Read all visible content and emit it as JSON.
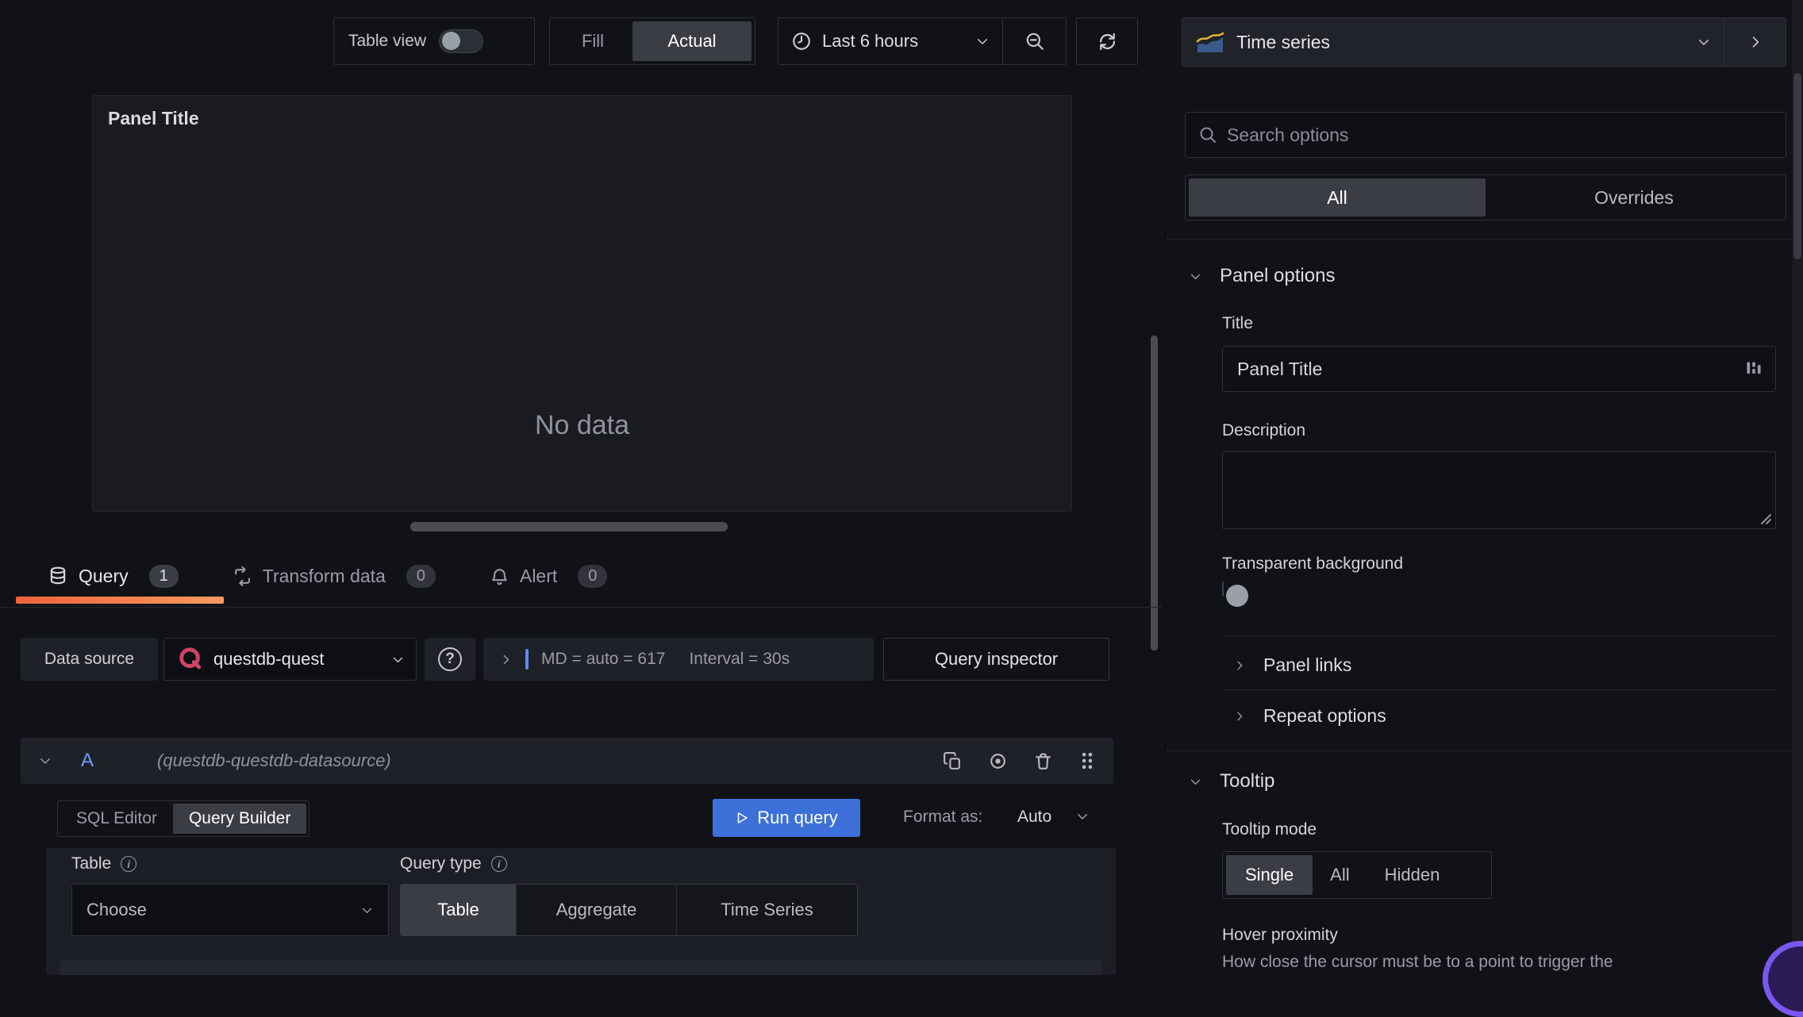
{
  "top_toolbar": {
    "table_view_label": "Table view",
    "fill_label": "Fill",
    "actual_label": "Actual",
    "time_range": "Last 6 hours"
  },
  "panel_preview": {
    "title": "Panel Title",
    "no_data": "No data"
  },
  "editor_tabs": {
    "query": {
      "label": "Query",
      "count": "1"
    },
    "transform": {
      "label": "Transform data",
      "count": "0"
    },
    "alert": {
      "label": "Alert",
      "count": "0"
    }
  },
  "query_toolbar": {
    "data_source_label": "Data source",
    "data_source_value": "questdb-quest",
    "summary_md": "MD = auto = 617",
    "summary_interval": "Interval = 30s",
    "query_inspector_label": "Query inspector"
  },
  "query_a": {
    "ref_id": "A",
    "datasource_hint": "(questdb-questdb-datasource)"
  },
  "query_editor": {
    "sql_editor_label": "SQL Editor",
    "query_builder_label": "Query Builder",
    "run_query_label": "Run query",
    "format_as_label": "Format as:",
    "format_value": "Auto",
    "table_label": "Table",
    "table_value": "Choose",
    "query_type_label": "Query type",
    "type_table": "Table",
    "type_aggregate": "Aggregate",
    "type_time_series": "Time Series"
  },
  "options_pane": {
    "visualization": "Time series",
    "search_placeholder": "Search options",
    "tab_all": "All",
    "tab_overrides": "Overrides",
    "panel_options_header": "Panel options",
    "title_label": "Title",
    "title_value": "Panel Title",
    "description_label": "Description",
    "transparent_background_label": "Transparent background",
    "panel_links_label": "Panel links",
    "repeat_options_label": "Repeat options",
    "tooltip_header": "Tooltip",
    "tooltip_mode_label": "Tooltip mode",
    "mode_single": "Single",
    "mode_all": "All",
    "mode_hidden": "Hidden",
    "hover_proximity_label": "Hover proximity",
    "hover_proximity_desc": "How close the cursor must be to a point to trigger the"
  },
  "colors": {
    "run_button_blue": "#3e70d9",
    "ref_id_blue": "#6e9fff",
    "active_tab_orange": "#f0633a",
    "questdb_pink": "#cf4368",
    "help_bubble_purple": "#7a57f0"
  }
}
